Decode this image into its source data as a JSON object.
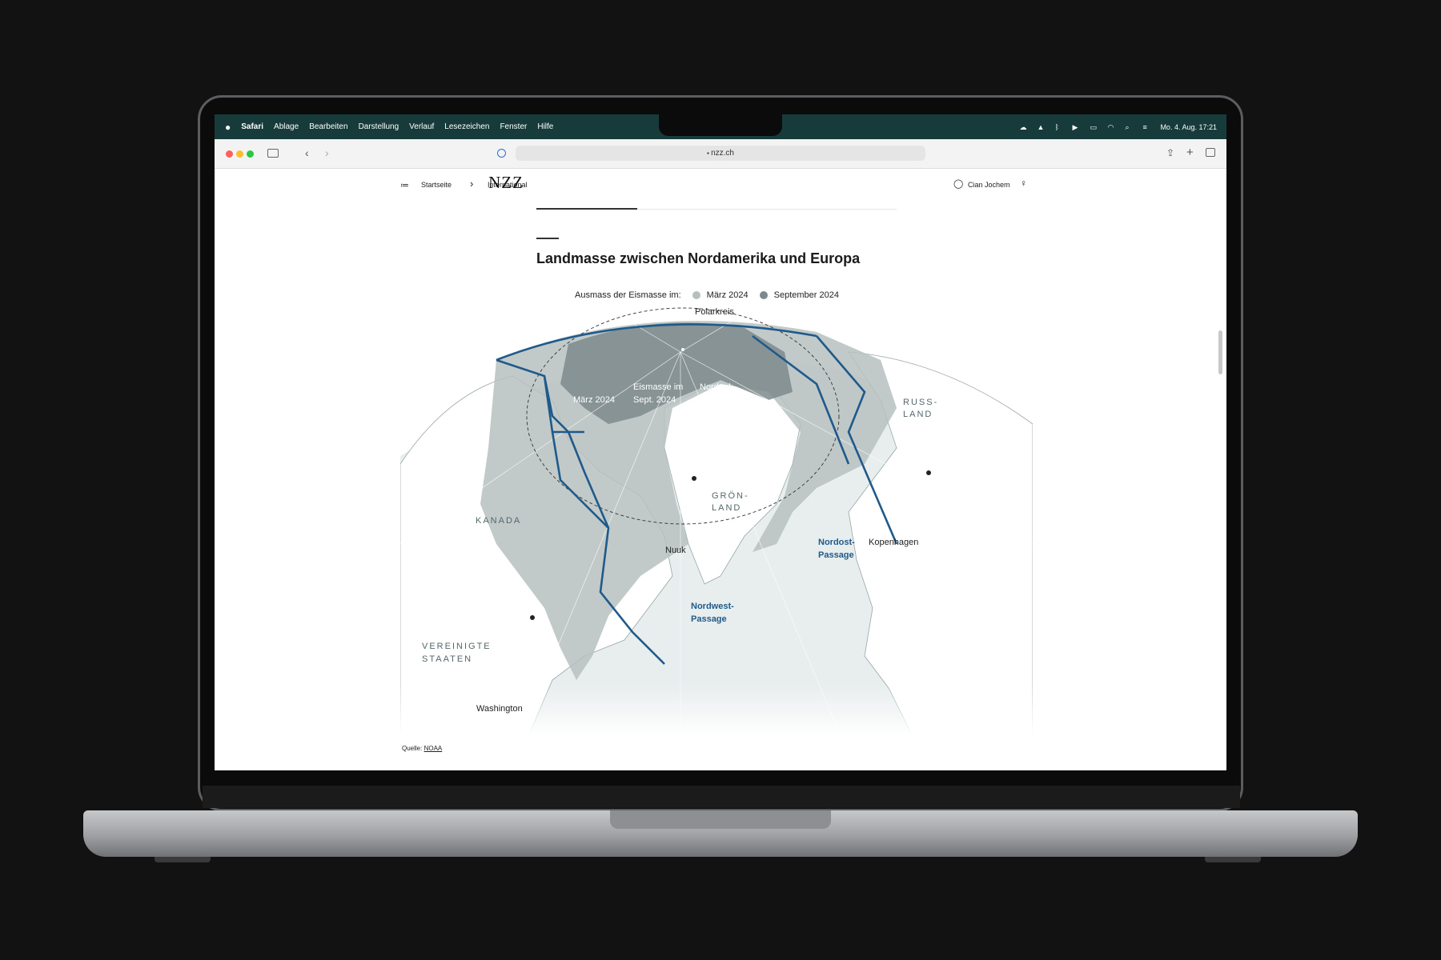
{
  "menubar": {
    "apple": "",
    "app": "Safari",
    "items": [
      "Ablage",
      "Bearbeiten",
      "Darstellung",
      "Verlauf",
      "Lesezeichen",
      "Fenster",
      "Hilfe"
    ],
    "clock": "Mo. 4. Aug.  17:21"
  },
  "browser": {
    "url": "nzz.ch"
  },
  "nav": {
    "breadcrumb_home": "Startseite",
    "breadcrumb_section": "International",
    "logo": "NZZ",
    "user": "Cian Jochem"
  },
  "article": {
    "title": "Landmasse zwischen Nordamerika und Europa",
    "legend_label": "Ausmass der Eismasse im:",
    "legend_march": "März 2024",
    "legend_sept": "September 2024",
    "source_label": "Quelle:",
    "source_link": "NOAA"
  },
  "map": {
    "polar_circle": "Polarkreis",
    "march_label": "März 2024",
    "sept_label_1": "Eismasse im",
    "sept_label_2": "Sept. 2024",
    "pole": "Nordpol",
    "russia_1": "RUSS-",
    "russia_2": "LAND",
    "greenland_1": "GRÖN-",
    "greenland_2": "LAND",
    "canada": "KANADA",
    "usa_1": "VEREINIGTE",
    "usa_2": "STAATEN",
    "nuuk": "Nuuk",
    "copenhagen": "Kopenhagen",
    "washington": "Washington",
    "northwest_1": "Nordwest-",
    "northwest_2": "Passage",
    "northeast_1": "Nordost-",
    "northeast_2": "Passage"
  },
  "colors": {
    "march_ice": "#b7bfbf",
    "sept_ice": "#7d8a8c",
    "route": "#1f5a8a",
    "menubar": "#173a3a"
  }
}
